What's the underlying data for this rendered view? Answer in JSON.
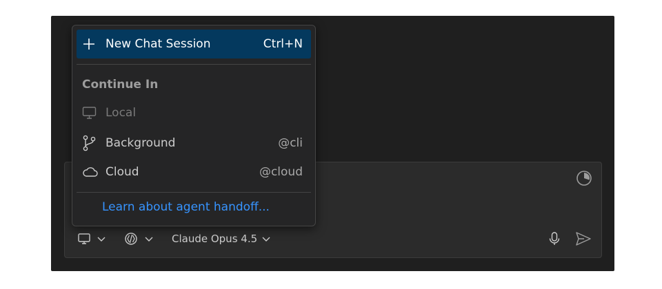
{
  "menu": {
    "new_chat": {
      "label": "New Chat Session",
      "shortcut": "Ctrl+N",
      "icon": "plus-icon"
    },
    "section_header": "Continue In",
    "items": [
      {
        "label": "Local",
        "shortcut": "",
        "icon": "monitor-icon",
        "disabled": true
      },
      {
        "label": "Background",
        "shortcut": "@cli",
        "icon": "source-control-icon",
        "disabled": false
      },
      {
        "label": "Cloud",
        "shortcut": "@cloud",
        "icon": "cloud-icon",
        "disabled": false
      }
    ],
    "link": "Learn about agent handoff..."
  },
  "input": {
    "model_label": "Claude Opus 4.5",
    "icons": [
      "monitor-icon",
      "chevron-down-icon",
      "agent-mode-icon",
      "chevron-down-icon",
      "chevron-down-icon",
      "microphone-icon",
      "send-icon",
      "context-usage-icon"
    ]
  },
  "colors": {
    "panel_bg": "#1f1f1f",
    "menu_bg": "#252526",
    "active_bg": "#04395e",
    "link": "#3794ff",
    "text": "#cccccc"
  }
}
